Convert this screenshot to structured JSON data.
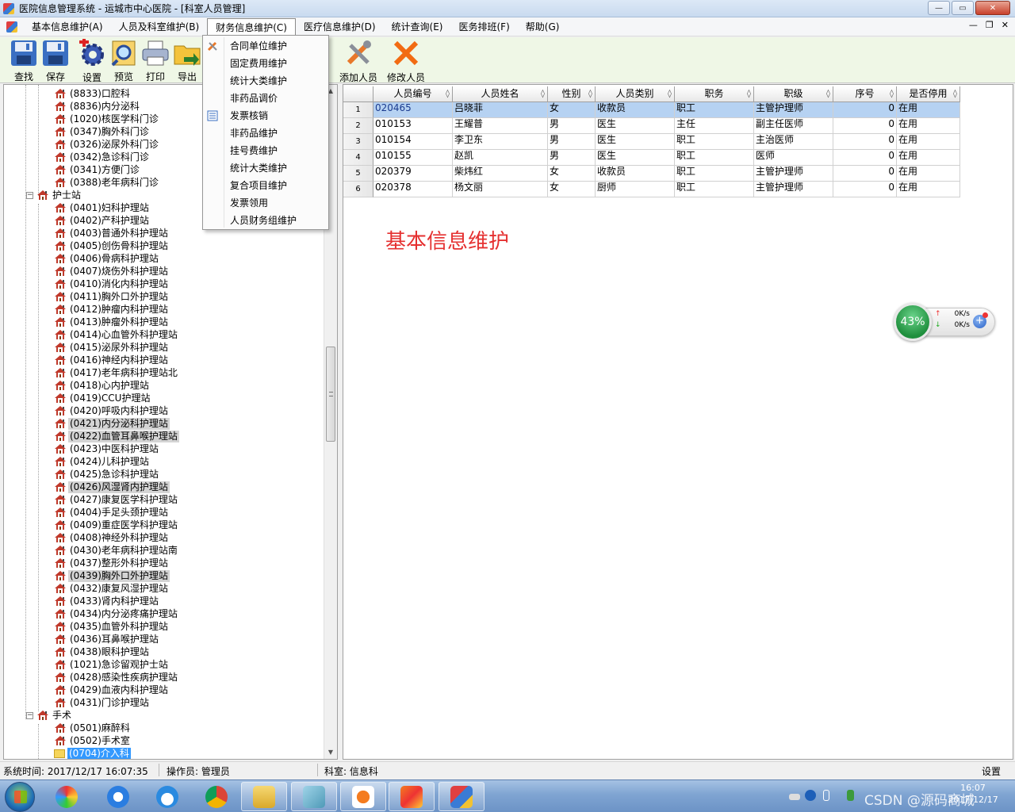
{
  "window": {
    "title": "医院信息管理系统   -   运城市中心医院 - [科室人员管理]",
    "controls": {
      "minimize": "—",
      "restore": "▭",
      "close": "✕"
    }
  },
  "menubar": {
    "items": [
      "基本信息维护(A)",
      "人员及科室维护(B)",
      "财务信息维护(C)",
      "医疗信息维护(D)",
      "统计查询(E)",
      "医务排班(F)",
      "帮助(G)"
    ],
    "mdi": {
      "minimize": "—",
      "restore": "❐",
      "close": "✕"
    }
  },
  "toolbar": {
    "buttons": [
      {
        "label": "查找",
        "icon": "floppy-disk-icon"
      },
      {
        "label": "保存",
        "icon": "floppy-disk-icon"
      },
      {
        "label": "设置",
        "icon": "gear-icon"
      },
      {
        "label": "预览",
        "icon": "preview-icon"
      },
      {
        "label": "打印",
        "icon": "printer-icon"
      },
      {
        "label": "导出",
        "icon": "folder-export-icon"
      },
      {
        "label": "添加人员",
        "icon": "tools-icon"
      },
      {
        "label": "修改人员",
        "icon": "cross-icon"
      }
    ]
  },
  "dropdown": {
    "items": [
      "合同单位维护",
      "固定费用维护",
      "统计大类维护",
      "非药品调价",
      "发票核销",
      "非药品维护",
      "挂号费维护",
      "统计大类维护",
      "复合项目维护",
      "发票领用",
      "人员财务组维护"
    ]
  },
  "tree": {
    "top_items": [
      "(8833)口腔科",
      "(8836)内分泌科",
      "(1020)核医学科门诊",
      "(0347)胸外科门诊",
      "(0326)泌尿外科门诊",
      "(0342)急诊科门诊",
      "(0341)方便门诊",
      "(0388)老年病科门诊"
    ],
    "nurse_group": "护士站",
    "nurse_items": [
      "(0401)妇科护理站",
      "(0402)产科护理站",
      "(0403)普通外科护理站",
      "(0405)创伤骨科护理站",
      "(0406)骨病科护理站",
      "(0407)烧伤外科护理站",
      "(0410)消化内科护理站",
      "(0411)胸外口外护理站",
      "(0412)肿瘤内科护理站",
      "(0413)肿瘤外科护理站",
      "(0414)心血管外科护理站",
      "(0415)泌尿外科护理站",
      "(0416)神经内科护理站",
      "(0417)老年病科护理站北",
      "(0418)心内护理站",
      "(0419)CCU护理站",
      "(0420)呼吸内科护理站",
      "(0421)内分泌科护理站",
      "(0422)血管耳鼻喉护理站",
      "(0423)中医科护理站",
      "(0424)儿科护理站",
      "(0425)急诊科护理站",
      "(0426)风湿肾内护理站",
      "(0427)康复医学科护理站",
      "(0404)手足头颈护理站",
      "(0409)重症医学科护理站",
      "(0408)神经外科护理站",
      "(0430)老年病科护理站南",
      "(0437)整形外科护理站",
      "(0439)胸外口外护理站",
      "(0432)康复风湿护理站",
      "(0433)肾内科护理站",
      "(0434)内分泌疼痛护理站",
      "(0435)血管外科护理站",
      "(0436)耳鼻喉护理站",
      "(0438)眼科护理站",
      "(1021)急诊留观护士站",
      "(0428)感染性疾病护理站",
      "(0429)血液内科护理站",
      "(0431)门诊护理站"
    ],
    "highlighted": [
      "(0421)内分泌科护理站",
      "(0422)血管耳鼻喉护理站",
      "(0426)风湿肾内护理站",
      "(0439)胸外口外护理站"
    ],
    "surgery_group": "手术",
    "surgery_items": [
      "(0501)麻醉科",
      "(0502)手术室"
    ],
    "selected_item": "(0704)介入科"
  },
  "grid": {
    "columns": [
      "人员编号",
      "人员姓名",
      "性别",
      "人员类别",
      "职务",
      "职级",
      "序号",
      "是否停用"
    ],
    "rows": [
      {
        "no": "1",
        "code": "020465",
        "name": "吕晓菲",
        "sex": "女",
        "type": "收款员",
        "duty": "职工",
        "rank": "主管护理师",
        "seq": "0",
        "status": "在用"
      },
      {
        "no": "2",
        "code": "010153",
        "name": "王耀普",
        "sex": "男",
        "type": "医生",
        "duty": "主任",
        "rank": "副主任医师",
        "seq": "0",
        "status": "在用"
      },
      {
        "no": "3",
        "code": "010154",
        "name": "李卫东",
        "sex": "男",
        "type": "医生",
        "duty": "职工",
        "rank": "主治医师",
        "seq": "0",
        "status": "在用"
      },
      {
        "no": "4",
        "code": "010155",
        "name": "赵凯",
        "sex": "男",
        "type": "医生",
        "duty": "职工",
        "rank": "医师",
        "seq": "0",
        "status": "在用"
      },
      {
        "no": "5",
        "code": "020379",
        "name": "柴炜红",
        "sex": "女",
        "type": "收款员",
        "duty": "职工",
        "rank": "主管护理师",
        "seq": "0",
        "status": "在用"
      },
      {
        "no": "6",
        "code": "020378",
        "name": "杨文丽",
        "sex": "女",
        "type": "厨师",
        "duty": "职工",
        "rank": "主管护理师",
        "seq": "0",
        "status": "在用"
      }
    ]
  },
  "overlay_label": "基本信息维护",
  "net_widget": {
    "percent": "43%",
    "up": "0K/s",
    "down": "0K/s"
  },
  "statusbar": {
    "time": "系统时间: 2017/12/17 16:07:35",
    "operator": "操作员: 管理员",
    "dept": "科室: 信息科",
    "settings": "设置"
  },
  "taskbar": {
    "watermark": "CSDN @源码商城",
    "clock_time": "16:07",
    "clock_date": "2017/12/17"
  },
  "colors": {
    "toolbar_bg": "#eff7e6",
    "selection": "#3399ff",
    "selected_row": "#b6d2f2",
    "overlay_text": "#e53030"
  }
}
